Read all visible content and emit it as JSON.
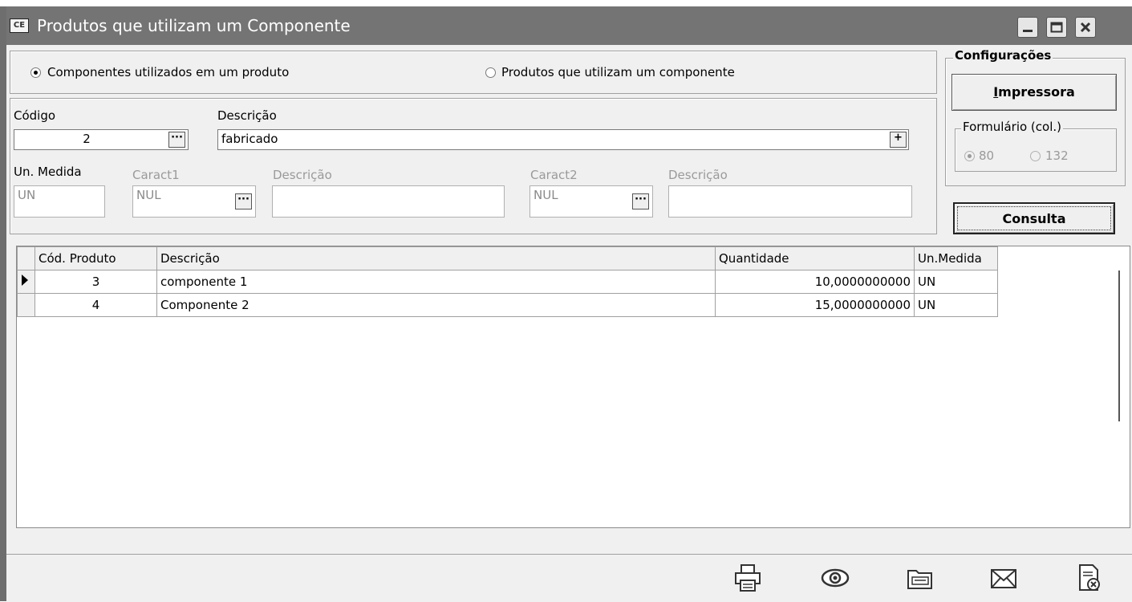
{
  "window": {
    "icon_text": "CE",
    "title": "Produtos que utilizam um Componente"
  },
  "mode": {
    "option1": "Componentes utilizados em um produto",
    "option2": "Produtos que utilizam um componente",
    "selected": "option1"
  },
  "filter": {
    "codigo_label": "Código",
    "codigo_value": "2",
    "descricao_label": "Descrição",
    "descricao_value": "fabricado",
    "un_medida_label": "Un. Medida",
    "un_medida_value": "UN",
    "caract1_label": "Caract1",
    "caract1_value": "NUL",
    "caract1_desc_label": "Descrição",
    "caract1_desc_value": "",
    "caract2_label": "Caract2",
    "caract2_value": "NUL",
    "caract2_desc_label": "Descrição",
    "caract2_desc_value": ""
  },
  "config": {
    "title": "Configurações",
    "printer_button": "Impressora",
    "form_label": "Formulário (col.)",
    "col80": "80",
    "col132": "132",
    "selected_col": "80",
    "consulta_button": "Consulta"
  },
  "grid": {
    "columns": [
      "Cód. Produto",
      "Descrição",
      "Quantidade",
      "Un.Medida"
    ],
    "rows": [
      {
        "codigo": "3",
        "descricao": "componente 1",
        "quantidade": "10,0000000000",
        "un": "UN"
      },
      {
        "codigo": "4",
        "descricao": "Componente 2",
        "quantidade": "15,0000000000",
        "un": "UN"
      }
    ]
  },
  "toolbar": {
    "icons": [
      "printer-icon",
      "preview-eye-icon",
      "folder-icon",
      "email-icon",
      "close-document-icon"
    ]
  }
}
